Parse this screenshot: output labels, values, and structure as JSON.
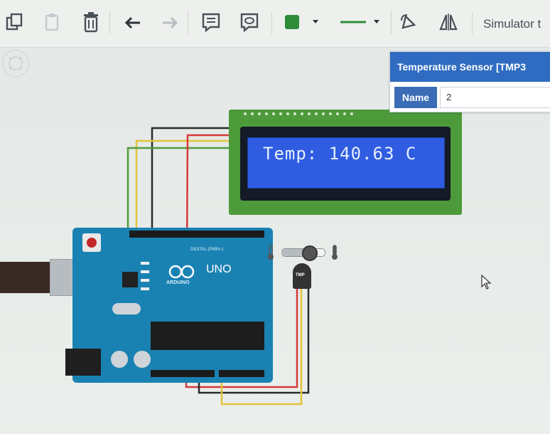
{
  "toolbar": {
    "tools": [
      {
        "name": "copy",
        "icon": "copy-icon"
      },
      {
        "name": "paste",
        "icon": "paste-icon"
      },
      {
        "name": "delete",
        "icon": "trash-icon"
      },
      {
        "name": "undo",
        "icon": "undo-icon"
      },
      {
        "name": "redo",
        "icon": "redo-icon"
      },
      {
        "name": "notes",
        "icon": "note-icon"
      },
      {
        "name": "toggle-notes",
        "icon": "speech-bubble-icon"
      },
      {
        "name": "color",
        "icon": "color-swatch-icon"
      },
      {
        "name": "line-style",
        "icon": "line-style-icon"
      },
      {
        "name": "rotate",
        "icon": "rotate-icon"
      },
      {
        "name": "flip",
        "icon": "mirror-icon"
      }
    ],
    "simulator_label": "Simulator t",
    "accent_color": "#2e8b3a"
  },
  "inspector": {
    "title": "Temperature Sensor [TMP3",
    "name_label": "Name",
    "name_value": "2",
    "accent_color": "#2f6cc1"
  },
  "lcd": {
    "display_text": "Temp: 140.63 C",
    "screen_color": "#2f5ce0",
    "board_color": "#4d9a3b"
  },
  "arduino": {
    "model_label": "UNO",
    "brand_label": "ARDUINO",
    "pins_label": "DIGITAL (PWM~)",
    "board_color": "#1a82b3"
  },
  "sensor": {
    "label": "TMP",
    "temperature_slider_level": 0.63
  },
  "wires": {
    "colors": {
      "black": "#2b2b2b",
      "red": "#d63a3a",
      "yellow": "#e2c43b",
      "green": "#4f9a3e"
    }
  }
}
